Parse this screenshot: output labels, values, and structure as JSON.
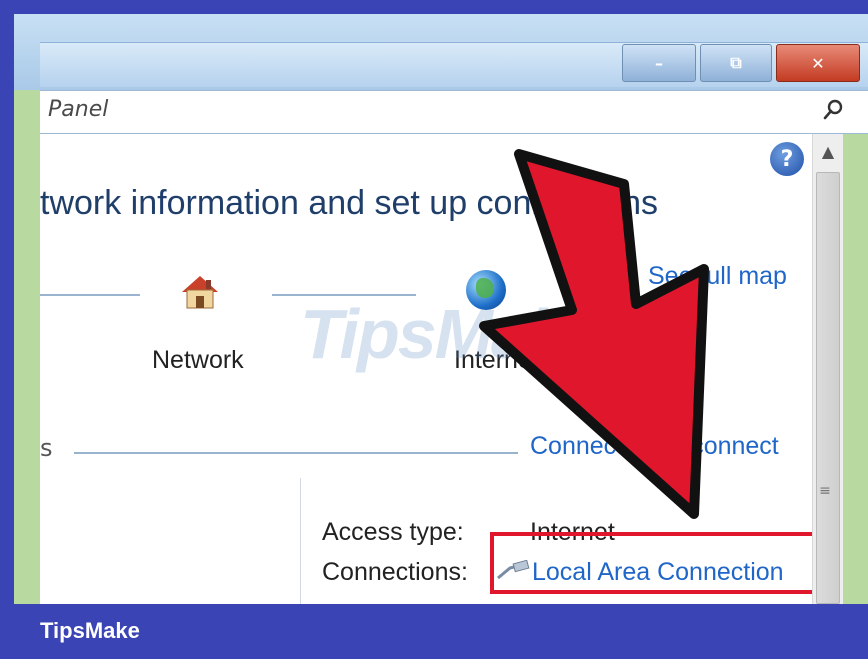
{
  "window": {
    "address_text": "Panel",
    "controls": {
      "minimize_glyph": "–",
      "restore_glyph": "⧉",
      "close_glyph": "✕"
    }
  },
  "content": {
    "heading": "twork information and set up connections",
    "see_full_map": "See full map",
    "network_label": "Network",
    "internet_label": "Internet",
    "section_fragment": "s",
    "connect_link": "Connect or disconnect",
    "access_type_label": "Access type:",
    "access_type_value": "Internet",
    "connections_label": "Connections:",
    "connection_link": "Local Area Connection",
    "help_glyph": "?"
  },
  "watermark": "TipsMake",
  "footer": {
    "brand": "TipsMake"
  },
  "colors": {
    "frame": "#3a44b4",
    "link": "#1f66c8",
    "highlight_box": "#e0172c",
    "arrow_fill": "#e0172c"
  }
}
